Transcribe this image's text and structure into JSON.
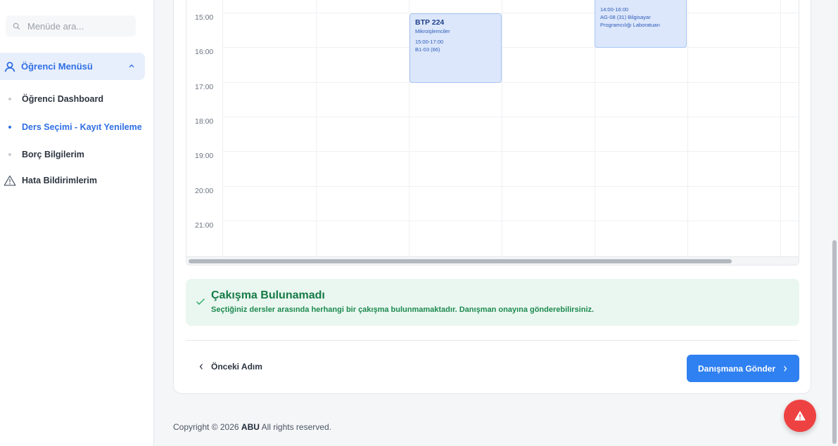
{
  "sidebar": {
    "search_placeholder": "Menüde ara...",
    "menu_title": "Öğrenci Menüsü",
    "items": [
      {
        "label": "Öğrenci Dashboard",
        "active": false
      },
      {
        "label": "Ders Seçimi - Kayıt Yenileme",
        "active": true
      },
      {
        "label": "Borç Bilgilerim",
        "active": false
      }
    ],
    "report_item": "Hata Bildirimlerim"
  },
  "schedule": {
    "times": [
      "15:00",
      "16:00",
      "17:00",
      "18:00",
      "19:00",
      "20:00",
      "21:00"
    ],
    "events": [
      {
        "code": "BTP 224",
        "name": "Mikroişlemciler",
        "time": "15:00-17:00",
        "room": "B1-03 (66)"
      },
      {
        "code": "",
        "name": "",
        "time": "14:00-16:00",
        "room": "AG-08 (31) Bilgisayar Programcılığı Laboratuarı"
      }
    ]
  },
  "alert": {
    "title": "Çakışma Bulunamadı",
    "message": "Seçtiğiniz dersler arasında herhangi bir çakışma bulunmamaktadır. Danışman onayına gönderebilirsiniz."
  },
  "actions": {
    "prev_label": "Önceki Adım",
    "send_label": "Danışmana Gönder"
  },
  "footer": {
    "prefix": "Copyright © 2026",
    "brand": "ABU",
    "suffix": "All rights reserved."
  },
  "colors": {
    "accent": "#2f80f0",
    "success": "#157a46",
    "danger": "#ee4242"
  }
}
